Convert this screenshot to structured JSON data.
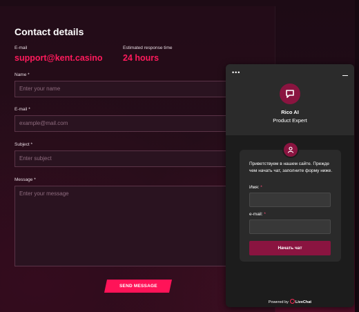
{
  "contact": {
    "title": "Contact details",
    "email_label": "E-mail",
    "email_value": "support@kent.casino",
    "response_label": "Estimated response time",
    "response_value": "24 hours"
  },
  "form": {
    "name_label": "Name",
    "name_placeholder": "Enter your name",
    "email_label": "E-mail",
    "email_placeholder": "example@mail.com",
    "subject_label": "Subject",
    "subject_placeholder": "Enter subject",
    "message_label": "Message",
    "message_placeholder": "Enter your message",
    "required_mark": "*",
    "send_label": "SEND MESSAGE"
  },
  "chat": {
    "menu_icon": "more-dots-icon",
    "minimize_icon": "minimize-icon",
    "agent_name": "Rico AI",
    "agent_role": "Product Expert",
    "greeting": "Приветствуем в нашем сайте. Прежде чем начать чат, заполните форму ниже.",
    "name_label": "Имя:",
    "email_label": "e-mail:",
    "required_mark": "*",
    "start_label": "Начать чат",
    "powered_prefix": "Powered by",
    "powered_brand": "LiveChat"
  },
  "colors": {
    "accent": "#ff1a5c",
    "chat_accent": "#8a1440",
    "background": "#1d0b15"
  }
}
